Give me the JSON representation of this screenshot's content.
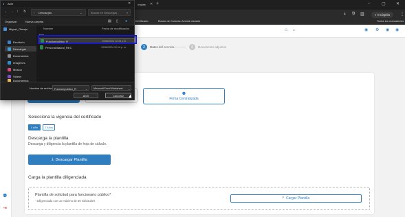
{
  "browser": {
    "tab_partial": "ongias",
    "bookmarks": [
      "ir Certificado",
      "Busdo de Cursess",
      "Aventa Usuario"
    ],
    "profile": "Incógnito",
    "folder_label": "Todos los marcadores"
  },
  "app": {
    "steps": [
      {
        "number": "2",
        "label": "Datos del servicio"
      },
      {
        "number": "3",
        "label": "Documento adjuntos"
      }
    ],
    "sidebar_icons": [
      "users-icon",
      "logout-icon"
    ],
    "firma_label": "Firma Centralizada",
    "vigencia_title": "Selecciona la vigencia del certificado",
    "vigencia_options": [
      {
        "label": "1 Año",
        "selected": true
      },
      {
        "label": "2 Años",
        "selected": false
      }
    ],
    "descarga_title": "Descarga la plantilla",
    "descarga_desc": "Descarga y diligencia la plantilla de hoja de cálculo.",
    "descarga_button": "Descargar Plantilla",
    "carga_title": "Carga la plantilla diligenciada",
    "plantilla_label": "Plantilla de solicitud para funcionario público*",
    "plantilla_hint": "- Diligenciada con un máximo de 50 solicitudes",
    "cargar_button": "Cargar Plantilla"
  },
  "dialog": {
    "title": "Abrir",
    "path": "Descargas",
    "search_placeholder": "Buscar en Descargas",
    "organize": "Organizar",
    "new_folder": "Nueva carpeta",
    "nav": [
      {
        "label": "Miguel_Olmeja",
        "icon": "cloud-folder-icon",
        "color": "#4a90d9"
      },
      {
        "label": "Escritorio",
        "icon": "desktop-icon",
        "color": "#3d7fc8"
      },
      {
        "label": "Descargas",
        "icon": "download-icon",
        "color": "#3d9bd6",
        "selected": true
      },
      {
        "label": "Documentos",
        "icon": "document-icon",
        "color": "#8c8c8c"
      },
      {
        "label": "Imágenes",
        "icon": "image-icon",
        "color": "#2f8fd1"
      },
      {
        "label": "Música",
        "icon": "music-icon",
        "color": "#d44a7a"
      },
      {
        "label": "Videos",
        "icon": "video-icon",
        "color": "#7a4fc9"
      },
      {
        "label": "Documentos",
        "icon": "folder-icon",
        "color": "#e8b84a"
      }
    ],
    "columns": {
      "name": "Nombre",
      "date": "Fecha de modificación"
    },
    "group": "Hoy",
    "files": [
      {
        "name": "Funcionpublico_R",
        "date": "19/06/2024 12:15 p.m.",
        "selected": true
      },
      {
        "name": "PersonaNatural_REC",
        "date": "19/06/2024 12:14 p. m.",
        "selected": false
      }
    ],
    "filename_label": "Nombre de archivo:",
    "filename_value": "Funcionpublico_R",
    "filetype": "Microsoft Excel Worksheet",
    "open_button": "Abrir",
    "cancel_button": "Cancelar"
  }
}
